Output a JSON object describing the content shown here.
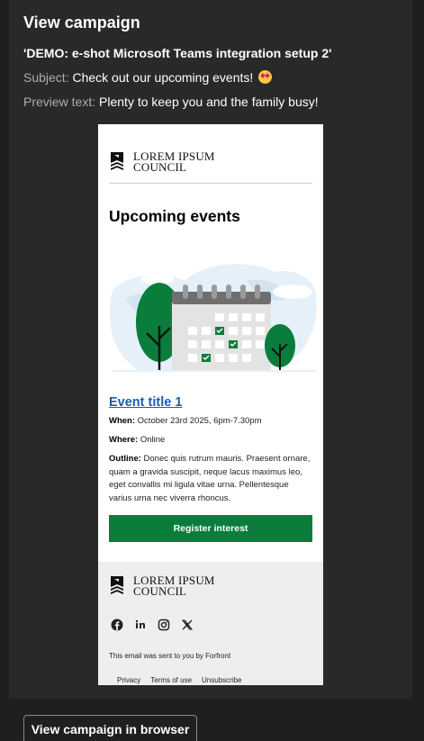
{
  "panel": {
    "title": "View campaign",
    "campaign_name": "'DEMO: e-shot Microsoft Teams integration setup 2'",
    "subject_label": "Subject:",
    "subject_value": "Check out our upcoming events!",
    "preview_label": "Preview text:",
    "preview_value": "Plenty to keep you and the family busy!"
  },
  "email": {
    "logo_line1": "LOREM IPSUM",
    "logo_line2": "COUNCIL",
    "heading": "Upcoming events",
    "event_title": "Event title 1",
    "when_label": "When:",
    "when_value": "October 23rd 2025, 6pm-7.30pm",
    "where_label": "Where:",
    "where_value": "Online",
    "outline_label": "Outline:",
    "outline_value": "Donec quis rutrum mauris. Praesent ornare, quam a gravida suscipit, neque lacus maximus leo, eget convallis mi ligula vitae urna. Pellentesque varius urna nec viverra rhoncus.",
    "register_label": "Register interest",
    "footer": {
      "logo_line1": "LOREM IPSUM",
      "logo_line2": "COUNCIL",
      "social_icons": [
        "facebook-icon",
        "linkedin-icon",
        "instagram-icon",
        "x-icon"
      ],
      "sent_by": "This email was sent to you by Forfront",
      "links": [
        "Privacy",
        "Terms of use",
        "Unsubscribe"
      ]
    }
  },
  "actions": {
    "view_in_browser": "View campaign in browser"
  },
  "colors": {
    "panel_bg": "#292929",
    "accent_green": "#0a7d3c",
    "link_blue": "#1d5ea8"
  }
}
